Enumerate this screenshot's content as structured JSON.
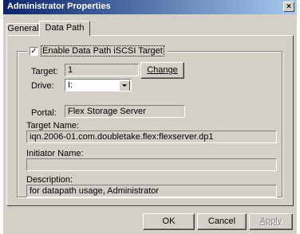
{
  "window": {
    "title": "Administrator Properties",
    "close_glyph": "×"
  },
  "tabs": [
    {
      "label": "General",
      "active": false
    },
    {
      "label": "Data Path",
      "active": true
    }
  ],
  "group": {
    "checkbox_label": "Enable Data Path iSCSI Target",
    "checkbox_checked": true,
    "check_glyph": "✓"
  },
  "target": {
    "label": "Target:",
    "value": "1",
    "change_button": "Change"
  },
  "drive": {
    "label": "Drive:",
    "value": "I:"
  },
  "portal": {
    "label": "Portal:",
    "value": "Flex Storage Server"
  },
  "target_name": {
    "label": "Target Name:",
    "value": "iqn.2006-01.com.doubletake.flex:flexserver.dp1"
  },
  "initiator_name": {
    "label": "Initiator Name:",
    "value": ""
  },
  "description": {
    "label": "Description:",
    "value": "for datapath usage, Administrator"
  },
  "buttons": {
    "ok": "OK",
    "cancel": "Cancel",
    "apply": "Apply"
  }
}
